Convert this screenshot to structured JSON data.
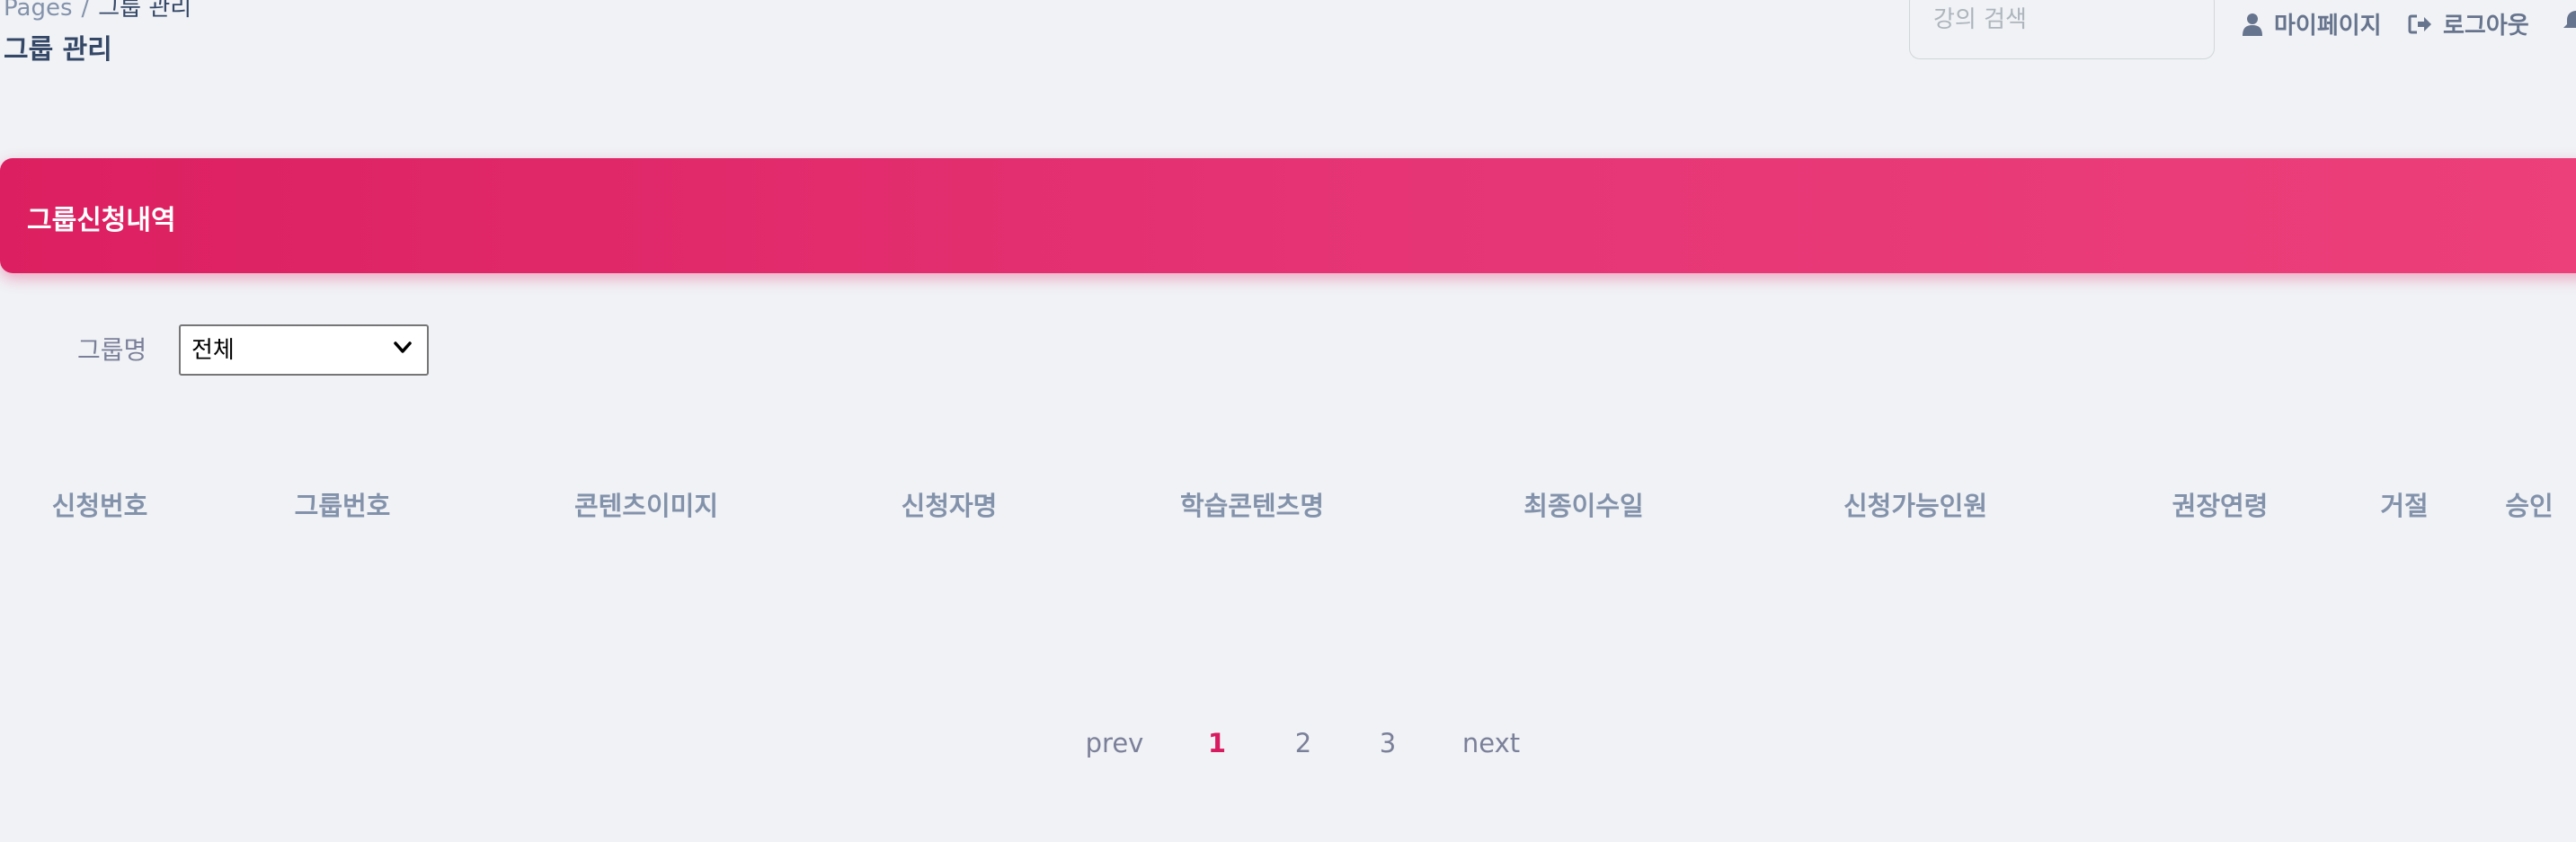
{
  "breadcrumb": {
    "root": "Pages",
    "separator": "/",
    "current": "그룹 관리"
  },
  "page_title": "그룹 관리",
  "search": {
    "placeholder": "강의 검색",
    "value": ""
  },
  "nav": {
    "mypage_label": "마이페이지",
    "logout_label": "로그아웃"
  },
  "card": {
    "title": "그룹신청내역",
    "accent_color": "#e91e63"
  },
  "filter": {
    "label": "그룹명",
    "selected": "전체",
    "options": [
      "전체"
    ]
  },
  "table": {
    "headers": [
      "신청번호",
      "그룹번호",
      "콘텐츠이미지",
      "신청자명",
      "학습콘텐츠명",
      "최종이수일",
      "신청가능인원",
      "권장연령",
      "거절",
      "승인"
    ],
    "rows": []
  },
  "pagination": {
    "prev": "prev",
    "pages": [
      "1",
      "2",
      "3"
    ],
    "current": "1",
    "next": "next"
  }
}
